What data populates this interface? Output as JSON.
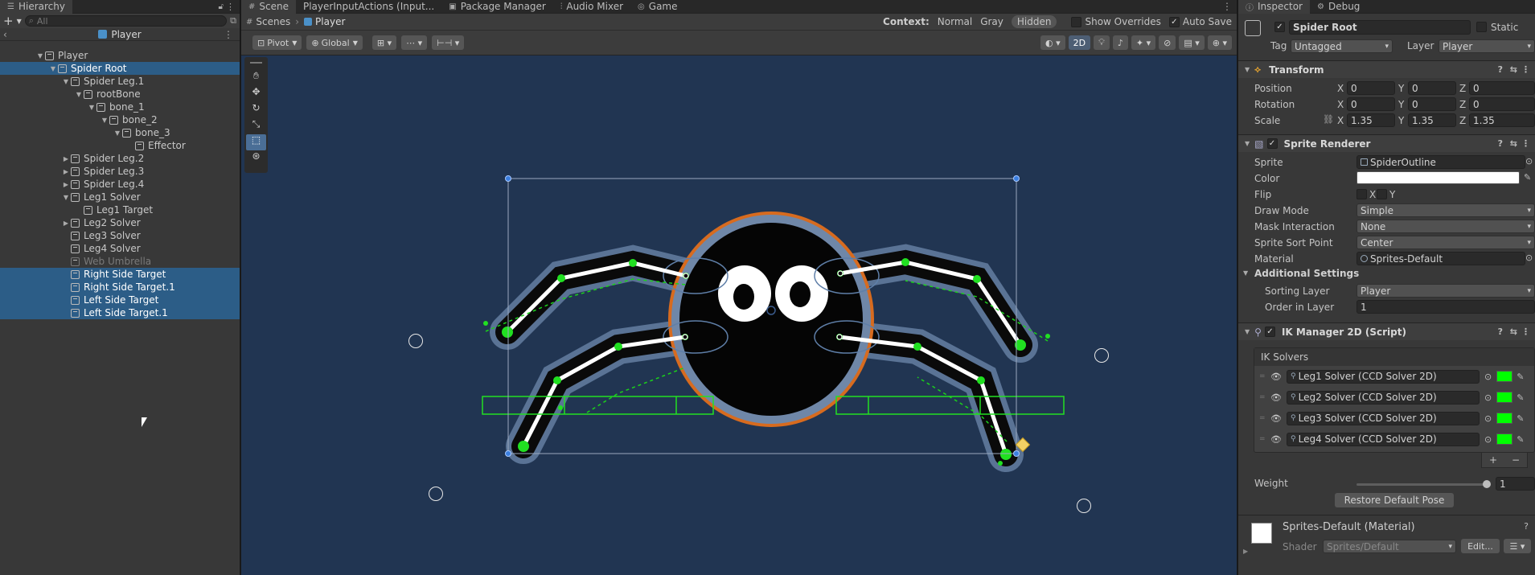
{
  "hierarchy": {
    "tab": "Hierarchy",
    "search_placeholder": "All",
    "scene_title": "Player",
    "items": [
      {
        "label": "Player",
        "indent": 0,
        "fold": "open",
        "selected": false,
        "faded": false
      },
      {
        "label": "Spider Root",
        "indent": 1,
        "fold": "open",
        "selected": true,
        "faded": false
      },
      {
        "label": "Spider Leg.1",
        "indent": 2,
        "fold": "open",
        "selected": false,
        "faded": false
      },
      {
        "label": "rootBone",
        "indent": 3,
        "fold": "open",
        "selected": false,
        "faded": false
      },
      {
        "label": "bone_1",
        "indent": 4,
        "fold": "open",
        "selected": false,
        "faded": false
      },
      {
        "label": "bone_2",
        "indent": 5,
        "fold": "open",
        "selected": false,
        "faded": false
      },
      {
        "label": "bone_3",
        "indent": 6,
        "fold": "open",
        "selected": false,
        "faded": false
      },
      {
        "label": "Effector",
        "indent": 7,
        "fold": "none",
        "selected": false,
        "faded": false
      },
      {
        "label": "Spider Leg.2",
        "indent": 2,
        "fold": "closed",
        "selected": false,
        "faded": false
      },
      {
        "label": "Spider Leg.3",
        "indent": 2,
        "fold": "closed",
        "selected": false,
        "faded": false
      },
      {
        "label": "Spider Leg.4",
        "indent": 2,
        "fold": "closed",
        "selected": false,
        "faded": false
      },
      {
        "label": "Leg1 Solver",
        "indent": 2,
        "fold": "open",
        "selected": false,
        "faded": false
      },
      {
        "label": "Leg1 Target",
        "indent": 3,
        "fold": "none",
        "selected": false,
        "faded": false
      },
      {
        "label": "Leg2 Solver",
        "indent": 2,
        "fold": "closed",
        "selected": false,
        "faded": false
      },
      {
        "label": "Leg3 Solver",
        "indent": 2,
        "fold": "none",
        "selected": false,
        "faded": false
      },
      {
        "label": "Leg4 Solver",
        "indent": 2,
        "fold": "none",
        "selected": false,
        "faded": false
      },
      {
        "label": "Web Umbrella",
        "indent": 2,
        "fold": "none",
        "selected": false,
        "faded": true
      },
      {
        "label": "Right Side Target",
        "indent": 2,
        "fold": "none",
        "selected": true,
        "faded": false
      },
      {
        "label": "Right Side Target.1",
        "indent": 2,
        "fold": "none",
        "selected": true,
        "faded": false
      },
      {
        "label": "Left Side Target",
        "indent": 2,
        "fold": "none",
        "selected": true,
        "faded": false
      },
      {
        "label": "Left Side Target.1",
        "indent": 2,
        "fold": "none",
        "selected": true,
        "faded": false
      }
    ]
  },
  "scene": {
    "tabs": [
      "Scene",
      "PlayerInputActions (Input...",
      "Package Manager",
      "Audio Mixer",
      "Game"
    ],
    "breadcrumb_root": "Scenes",
    "breadcrumb_current": "Player",
    "context_label": "Context:",
    "context_options": [
      "Normal",
      "Gray",
      "Hidden"
    ],
    "context_selected": "Hidden",
    "show_overrides": "Show Overrides",
    "auto_save": "Auto Save",
    "pivot": "Pivot",
    "global": "Global",
    "mode_2d": "2D"
  },
  "inspector": {
    "tabs": [
      "Inspector",
      "Debug"
    ],
    "object_name": "Spider Root",
    "static_label": "Static",
    "tag_label": "Tag",
    "tag_value": "Untagged",
    "layer_label": "Layer",
    "layer_value": "Player",
    "transform": {
      "title": "Transform",
      "position": {
        "label": "Position",
        "x": "0",
        "y": "0",
        "z": "0"
      },
      "rotation": {
        "label": "Rotation",
        "x": "0",
        "y": "0",
        "z": "0"
      },
      "scale": {
        "label": "Scale",
        "x": "1.35",
        "y": "1.35",
        "z": "1.35"
      }
    },
    "sprite_renderer": {
      "title": "Sprite Renderer",
      "sprite_label": "Sprite",
      "sprite_value": "SpiderOutline",
      "color_label": "Color",
      "color_value": "#ffffff",
      "flip_label": "Flip",
      "flip_x": "X",
      "flip_y": "Y",
      "draw_mode_label": "Draw Mode",
      "draw_mode_value": "Simple",
      "mask_label": "Mask Interaction",
      "mask_value": "None",
      "sort_point_label": "Sprite Sort Point",
      "sort_point_value": "Center",
      "material_label": "Material",
      "material_value": "Sprites-Default",
      "additional_label": "Additional Settings",
      "sorting_layer_label": "Sorting Layer",
      "sorting_layer_value": "Player",
      "order_label": "Order in Layer",
      "order_value": "1"
    },
    "ik_manager": {
      "title": "IK Manager 2D (Script)",
      "solvers_label": "IK Solvers",
      "solvers": [
        "Leg1 Solver (CCD Solver 2D)",
        "Leg2 Solver (CCD Solver 2D)",
        "Leg3 Solver (CCD Solver 2D)",
        "Leg4 Solver (CCD Solver 2D)"
      ],
      "solver_color": "#00ff00",
      "add": "+",
      "remove": "−",
      "weight_label": "Weight",
      "weight_value": "1",
      "weight_fraction": 1.0,
      "restore_button": "Restore Default Pose"
    },
    "material": {
      "name": "Sprites-Default (Material)",
      "shader_label": "Shader",
      "shader_value": "Sprites/Default",
      "edit_button": "Edit..."
    }
  }
}
